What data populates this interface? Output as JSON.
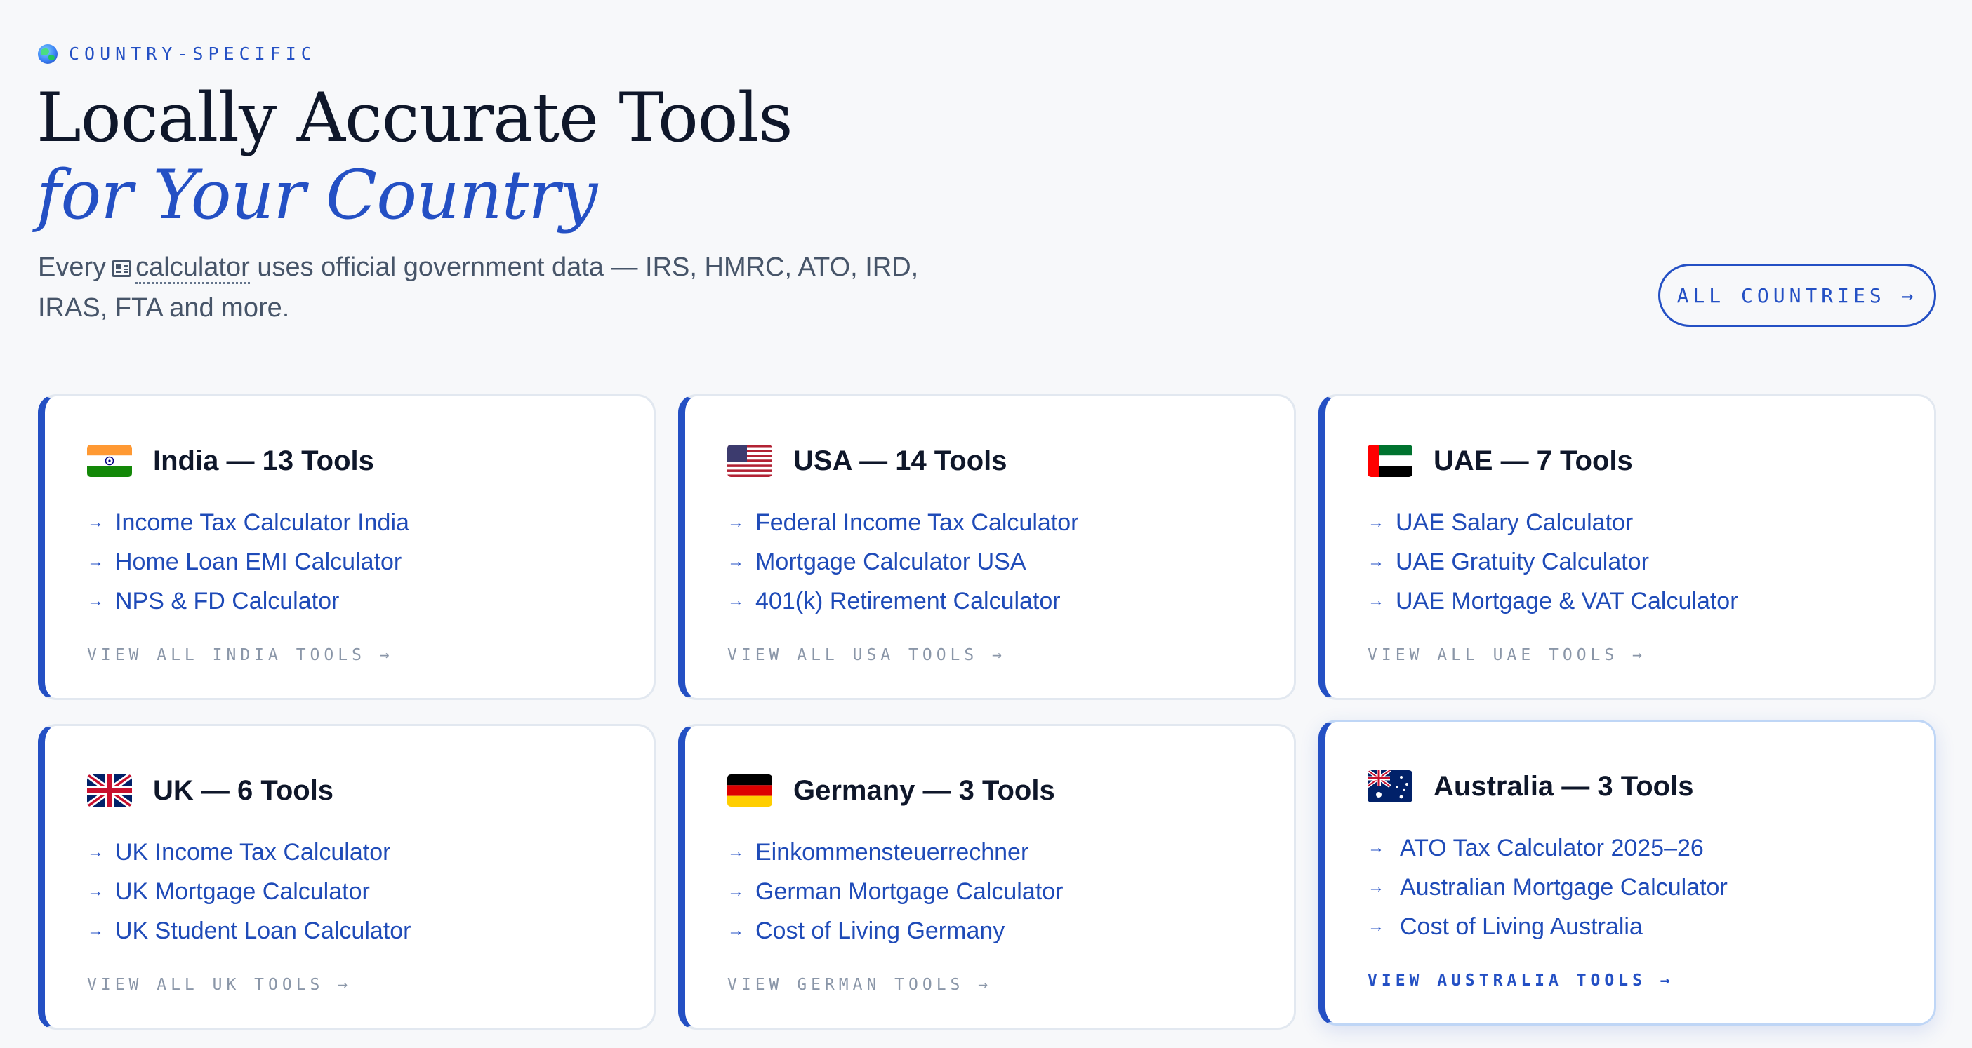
{
  "eyebrow": {
    "icon": "globe-icon",
    "text": "COUNTRY-SPECIFIC"
  },
  "title": {
    "line1": "Locally Accurate Tools",
    "line2": "for Your Country"
  },
  "subtitle": {
    "before": "Every",
    "icon": "calculator-icon",
    "keyword": "calculator",
    "after_line1": "uses official government data — IRS, HMRC, ATO, IRD,",
    "line2": "IRAS, FTA and more."
  },
  "all_countries_button": "ALL COUNTRIES →",
  "arrow_glyph": "→",
  "colors": {
    "accent": "#2450c4",
    "text": "#0f172a",
    "muted": "#8a96a8",
    "background": "#f7f8fa"
  },
  "cards": [
    {
      "flag": "india-flag",
      "title": "India — 13 Tools",
      "links": [
        "Income Tax Calculator India",
        "Home Loan EMI Calculator",
        "NPS & FD Calculator"
      ],
      "view_all": "VIEW ALL INDIA TOOLS →"
    },
    {
      "flag": "usa-flag",
      "title": "USA — 14 Tools",
      "links": [
        "Federal Income Tax Calculator",
        "Mortgage Calculator USA",
        "401(k) Retirement Calculator"
      ],
      "view_all": "VIEW ALL USA TOOLS →"
    },
    {
      "flag": "uae-flag",
      "title": "UAE — 7 Tools",
      "links": [
        "UAE Salary Calculator",
        "UAE Gratuity Calculator",
        "UAE Mortgage & VAT Calculator"
      ],
      "view_all": "VIEW ALL UAE TOOLS →"
    },
    {
      "flag": "uk-flag",
      "title": "UK — 6 Tools",
      "links": [
        "UK Income Tax Calculator",
        "UK Mortgage Calculator",
        "UK Student Loan Calculator"
      ],
      "view_all": "VIEW ALL UK TOOLS →"
    },
    {
      "flag": "germany-flag",
      "title": "Germany — 3 Tools",
      "links": [
        "Einkommensteuerrechner",
        "German Mortgage Calculator",
        "Cost of Living Germany"
      ],
      "view_all": "VIEW GERMAN TOOLS →"
    },
    {
      "flag": "australia-flag",
      "title": "Australia — 3 Tools",
      "links": [
        "ATO Tax Calculator 2025–26",
        "Australian Mortgage Calculator",
        "Cost of Living Australia"
      ],
      "view_all": "VIEW AUSTRALIA TOOLS →"
    }
  ]
}
